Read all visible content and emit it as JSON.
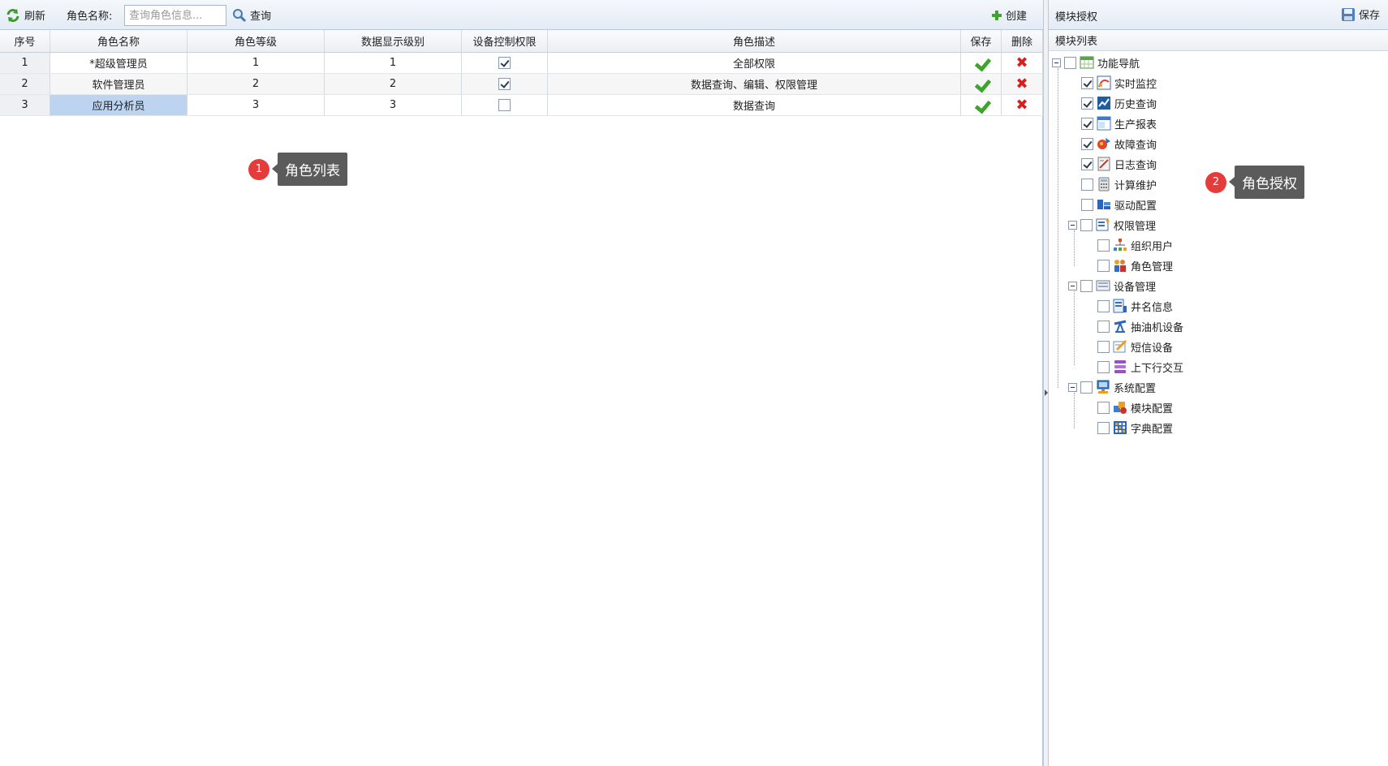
{
  "toolbar": {
    "refresh_label": "刷新",
    "role_name_label": "角色名称:",
    "search_placeholder": "查询角色信息...",
    "query_label": "查询",
    "create_label": "创建"
  },
  "table": {
    "columns": [
      "序号",
      "角色名称",
      "角色等级",
      "数据显示级别",
      "设备控制权限",
      "角色描述",
      "保存",
      "删除"
    ],
    "rows": [
      {
        "index": "1",
        "name": "*超级管理员",
        "level": "1",
        "data_level": "1",
        "device_control": true,
        "desc": "全部权限"
      },
      {
        "index": "2",
        "name": "软件管理员",
        "level": "2",
        "data_level": "2",
        "device_control": true,
        "desc": "数据查询、编辑、权限管理"
      },
      {
        "index": "3",
        "name": "应用分析员",
        "level": "3",
        "data_level": "3",
        "device_control": false,
        "desc": "数据查询"
      }
    ]
  },
  "callouts": {
    "one": {
      "num": "1",
      "text": "角色列表"
    },
    "two": {
      "num": "2",
      "text": "角色授权"
    }
  },
  "right_panel": {
    "title": "模块授权",
    "save_label": "保存",
    "sub_title": "模块列表",
    "tree": {
      "root": {
        "label": "功能导航",
        "checked": false,
        "icon": "calendar-grid-icon"
      },
      "items": [
        {
          "label": "实时监控",
          "checked": true,
          "icon": "realtime-chart-icon"
        },
        {
          "label": "历史查询",
          "checked": true,
          "icon": "line-chart-icon"
        },
        {
          "label": "生产报表",
          "checked": true,
          "icon": "report-table-icon"
        },
        {
          "label": "故障查询",
          "checked": true,
          "icon": "fault-icon"
        },
        {
          "label": "日志查询",
          "checked": true,
          "icon": "log-icon"
        },
        {
          "label": "计算维护",
          "checked": false,
          "icon": "calculator-icon"
        },
        {
          "label": "驱动配置",
          "checked": false,
          "icon": "driver-icon"
        }
      ],
      "groups": [
        {
          "label": "权限管理",
          "checked": false,
          "icon": "permission-icon",
          "children": [
            {
              "label": "组织用户",
              "checked": false,
              "icon": "org-chart-icon"
            },
            {
              "label": "角色管理",
              "checked": false,
              "icon": "users-icon"
            }
          ]
        },
        {
          "label": "设备管理",
          "checked": false,
          "icon": "device-icon",
          "children": [
            {
              "label": "井名信息",
              "checked": false,
              "icon": "well-info-icon"
            },
            {
              "label": "抽油机设备",
              "checked": false,
              "icon": "pump-icon"
            },
            {
              "label": "短信设备",
              "checked": false,
              "icon": "sms-icon"
            },
            {
              "label": "上下行交互",
              "checked": false,
              "icon": "stack-icon"
            }
          ]
        },
        {
          "label": "系统配置",
          "checked": false,
          "icon": "system-config-icon",
          "children": [
            {
              "label": "模块配置",
              "checked": false,
              "icon": "module-config-icon"
            },
            {
              "label": "字典配置",
              "checked": false,
              "icon": "dictionary-grid-icon"
            }
          ]
        }
      ]
    }
  },
  "colors": {
    "accent": "#3ea52c",
    "delete": "#d91e1e",
    "selection": "#bcd4f0",
    "callout_badge": "#e43b3b"
  }
}
